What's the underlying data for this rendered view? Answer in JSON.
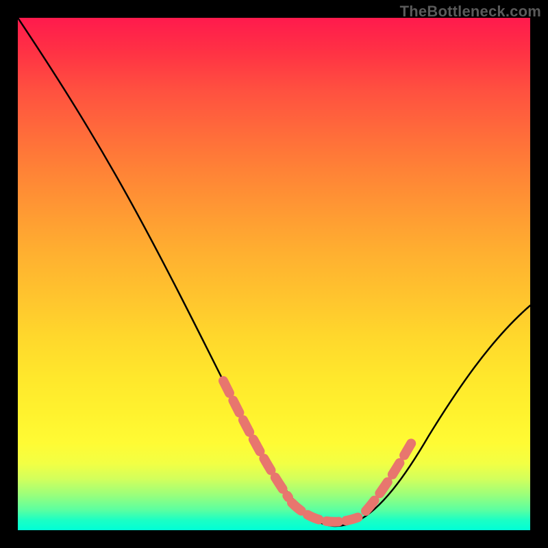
{
  "watermark": "TheBottleneck.com",
  "chart_data": {
    "type": "line",
    "title": "",
    "xlabel": "",
    "ylabel": "",
    "xlim": [
      0,
      100
    ],
    "ylim": [
      0,
      100
    ],
    "series": [
      {
        "name": "bottleneck-curve",
        "x": [
          0,
          5,
          10,
          15,
          20,
          25,
          30,
          35,
          40,
          45,
          50,
          52,
          55,
          57,
          60,
          62,
          65,
          70,
          75,
          80,
          85,
          90,
          95,
          100
        ],
        "y": [
          100,
          93,
          85,
          77,
          69,
          60,
          51,
          42,
          33,
          24,
          15,
          10,
          5,
          2,
          0,
          0,
          2,
          7,
          14,
          21,
          28,
          35,
          41,
          47
        ]
      }
    ],
    "highlight_segments": [
      {
        "x": [
          38,
          56
        ],
        "note": "left-descent-highlight"
      },
      {
        "x": [
          55,
          66
        ],
        "note": "valley-floor-highlight"
      },
      {
        "x": [
          66,
          74
        ],
        "note": "right-ascent-highlight"
      }
    ],
    "background_gradient": {
      "top": "#ff1a4d",
      "mid": "#ffe72c",
      "bottom": "#00ffd6"
    }
  }
}
